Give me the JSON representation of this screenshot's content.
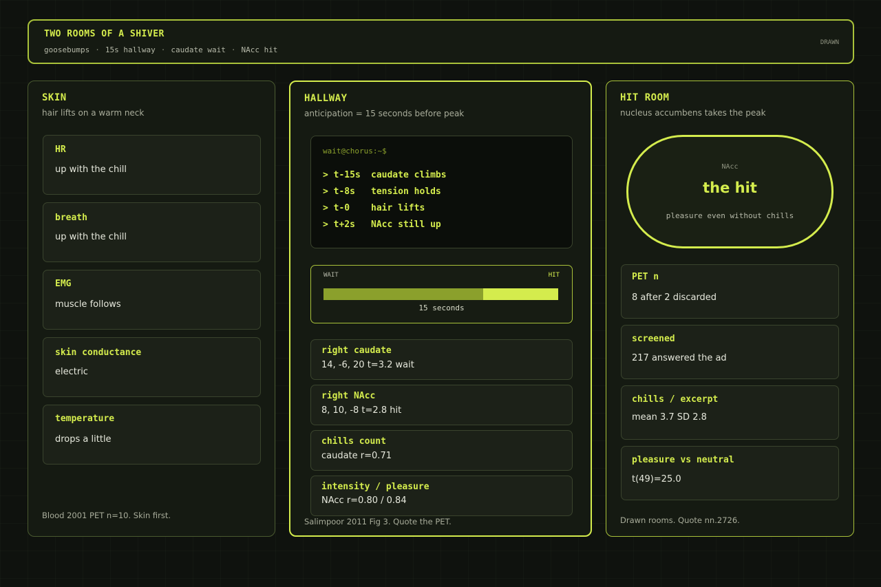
{
  "header": {
    "title": "TWO ROOMS OF A SHIVER",
    "subtitle_parts": [
      "goosebumps",
      "15s hallway",
      "caudate wait",
      "NAcc hit"
    ],
    "separator": "·",
    "badge": "DRAWN"
  },
  "skin": {
    "title": "SKIN",
    "subtitle": "hair lifts on a warm neck",
    "cards": [
      {
        "label": "HR",
        "value": "up with the chill"
      },
      {
        "label": "breath",
        "value": "up with the chill"
      },
      {
        "label": "EMG",
        "value": "muscle follows"
      },
      {
        "label": "skin conductance",
        "value": "electric"
      },
      {
        "label": "temperature",
        "value": "drops a little"
      }
    ],
    "footer": "Blood 2001 PET n=10. Skin first."
  },
  "hallway": {
    "title": "HALLWAY",
    "subtitle": "anticipation = 15 seconds before peak",
    "terminal": {
      "prompt": "wait@chorus:~$",
      "lines": [
        {
          "t": "> t-15s",
          "text": "caudate climbs"
        },
        {
          "t": "> t-8s",
          "text": "tension holds"
        },
        {
          "t": "> t-0",
          "text": "hair lifts"
        },
        {
          "t": "> t+2s",
          "text": "NAcc still up"
        }
      ]
    },
    "wait_bar": {
      "left_label": "WAIT",
      "right_label": "HIT",
      "wait_fraction": 0.68,
      "caption": "15 seconds"
    },
    "cards": [
      {
        "label": "right caudate",
        "value": "14, -6, 20  t=3.2  wait"
      },
      {
        "label": "right NAcc",
        "value": "8, 10, -8  t=2.8  hit"
      },
      {
        "label": "chills count",
        "value": "caudate r=0.71"
      },
      {
        "label": "intensity / pleasure",
        "value": "NAcc r=0.80 / 0.84"
      }
    ],
    "footer": "Salimpoor 2011 Fig 3. Quote the PET."
  },
  "hit_room": {
    "title": "HIT ROOM",
    "subtitle": "nucleus accumbens takes the peak",
    "oval": {
      "tag": "NAcc",
      "headline": "the hit",
      "caption": "pleasure even without chills"
    },
    "cards": [
      {
        "label": "PET n",
        "value": "8 after 2 discarded"
      },
      {
        "label": "screened",
        "value": "217 answered the ad"
      },
      {
        "label": "chills / excerpt",
        "value": "mean 3.7  SD 2.8"
      },
      {
        "label": "pleasure vs neutral",
        "value": "t(49)=25.0"
      }
    ],
    "footer": "Drawn rooms. Quote nn.2726."
  },
  "colors": {
    "accent": "#d4ec4d",
    "accent_dim": "#8ba02c",
    "background": "#0f120e"
  }
}
